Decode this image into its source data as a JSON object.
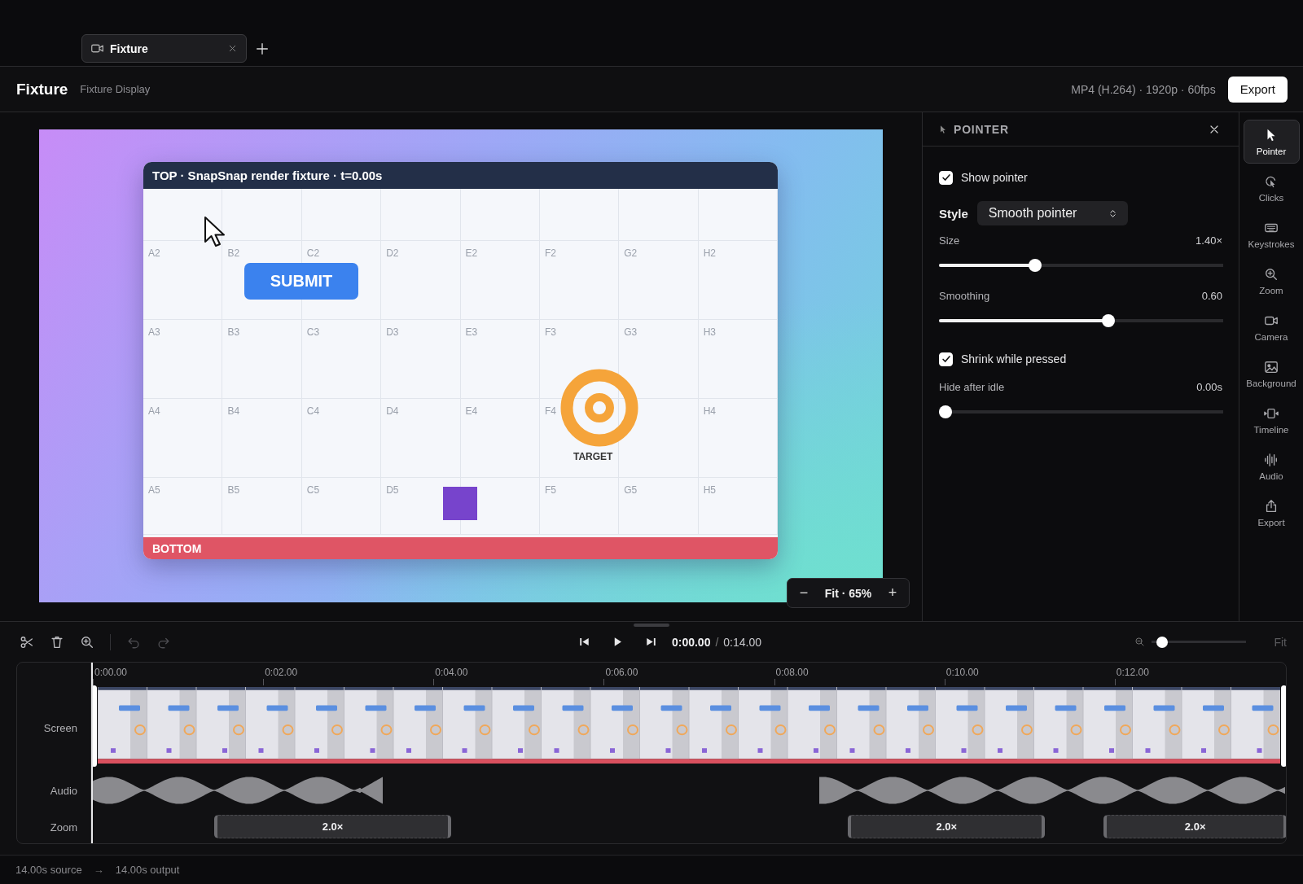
{
  "tabs": [
    {
      "label": "Fixture",
      "selected": true
    }
  ],
  "header": {
    "title": "Fixture",
    "subtitle": "Fixture Display",
    "format": "MP4 (H.264) · 1920p · 60fps",
    "export_button": "Export"
  },
  "preview": {
    "fixture": {
      "header": "TOP · SnapSnap render fixture · t=0.00s",
      "footer": "BOTTOM",
      "button": "SUBMIT",
      "target_label": "TARGET",
      "rows": [
        [
          null,
          null,
          null,
          null,
          null,
          null,
          null,
          null
        ],
        [
          "A2",
          "B2",
          "C2",
          "D2",
          "E2",
          "F2",
          "G2",
          "H2"
        ],
        [
          "A3",
          "B3",
          "C3",
          "D3",
          "E3",
          "F3",
          "G3",
          "H3"
        ],
        [
          "A4",
          "B4",
          "C4",
          "D4",
          "E4",
          "F4",
          null,
          "H4"
        ],
        [
          "A5",
          "B5",
          "C5",
          "D5",
          null,
          "F5",
          "G5",
          "H5"
        ]
      ]
    },
    "zoom_control": {
      "minus": "−",
      "label": "Fit · 65%",
      "plus": "+"
    }
  },
  "panel": {
    "title": "POINTER",
    "controls": [
      {
        "kind": "checkbox",
        "label": "Show pointer",
        "checked": true
      },
      {
        "kind": "select",
        "label": "Style",
        "value": "Smooth pointer"
      },
      {
        "kind": "slider",
        "label": "Size",
        "reading": "1.40×",
        "level": 0.33
      },
      {
        "kind": "slider",
        "label": "Smoothing",
        "reading": "0.60",
        "level": 0.6
      },
      {
        "kind": "checkbox",
        "label": "Shrink while pressed",
        "checked": true
      },
      {
        "kind": "slider",
        "label": "Hide after idle",
        "reading": "0.00s",
        "level": 0
      }
    ]
  },
  "rail": [
    {
      "kind": "pointer",
      "label": "Pointer",
      "selected": true
    },
    {
      "kind": "clicks",
      "label": "Clicks",
      "selected": false
    },
    {
      "kind": "keystrokes",
      "label": "Keystrokes",
      "selected": false
    },
    {
      "kind": "zoom",
      "label": "Zoom",
      "selected": false
    },
    {
      "kind": "camera",
      "label": "Camera",
      "selected": false
    },
    {
      "kind": "background",
      "label": "Background",
      "selected": false
    },
    {
      "kind": "timeline",
      "label": "Timeline",
      "selected": false
    },
    {
      "kind": "audio",
      "label": "Audio",
      "selected": false
    },
    {
      "kind": "export",
      "label": "Export",
      "selected": false
    }
  ],
  "timeline": {
    "tools": [
      {
        "kind": "cut",
        "disabled": false
      },
      {
        "kind": "delete",
        "disabled": false
      },
      {
        "kind": "zoom",
        "disabled": false
      },
      {
        "kind": "undo",
        "disabled": true
      },
      {
        "kind": "redo",
        "disabled": true
      }
    ],
    "current_time": "0:00.00",
    "separator": "/",
    "duration": "0:14.00",
    "zoom_slider": {
      "level": 0.05
    },
    "fit_button": {
      "label": "Fit",
      "disabled": true
    },
    "ruler": [
      "0:00.00",
      "0:02.00",
      "0:04.00",
      "0:06.00",
      "0:08.00",
      "0:10.00",
      "0:12.00"
    ],
    "tracks": [
      {
        "kind": "screen",
        "label": "Screen"
      },
      {
        "kind": "audio",
        "label": "Audio"
      },
      {
        "kind": "zoom",
        "label": "Zoom",
        "segments": [
          {
            "label": "2.0×"
          },
          {
            "label": "2.0×"
          },
          {
            "label": "2.0×"
          }
        ]
      }
    ]
  },
  "status": {
    "source": "14.00s source",
    "arrow": "→",
    "output": "14.00s output"
  }
}
